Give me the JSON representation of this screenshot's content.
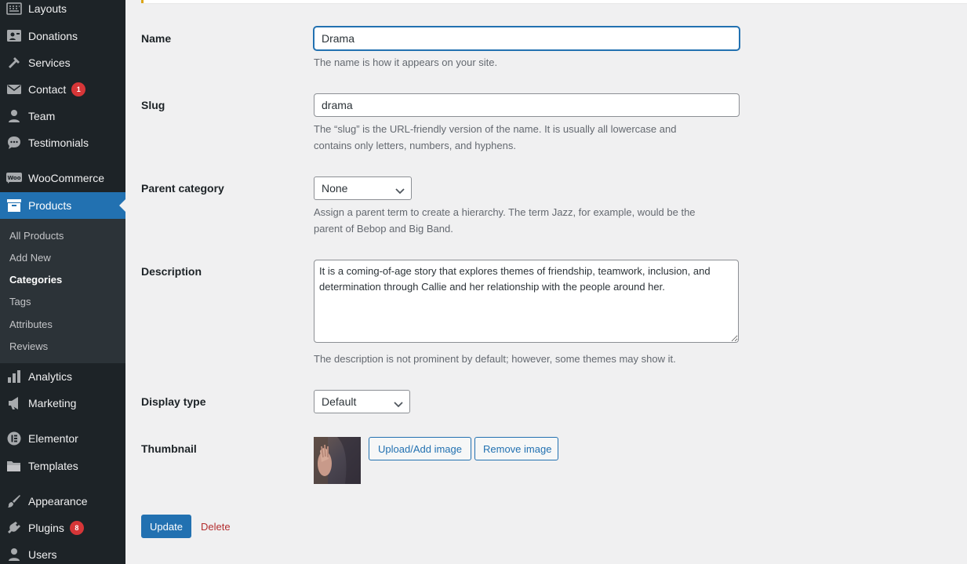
{
  "sidebar": {
    "items": [
      {
        "label": "Layouts",
        "icon": "layouts-icon"
      },
      {
        "label": "Donations",
        "icon": "donations-icon"
      },
      {
        "label": "Services",
        "icon": "hammer-icon"
      },
      {
        "label": "Contact",
        "icon": "mail-icon",
        "badge": "1"
      },
      {
        "label": "Team",
        "icon": "person-icon"
      },
      {
        "label": "Testimonials",
        "icon": "comment-icon"
      },
      {
        "label": "WooCommerce",
        "icon": "woocommerce-icon"
      },
      {
        "label": "Products",
        "icon": "archive-icon",
        "current": true
      },
      {
        "label": "Analytics",
        "icon": "bar-chart-icon"
      },
      {
        "label": "Marketing",
        "icon": "megaphone-icon"
      },
      {
        "label": "Elementor",
        "icon": "elementor-icon"
      },
      {
        "label": "Templates",
        "icon": "folder-icon"
      },
      {
        "label": "Appearance",
        "icon": "paintbrush-icon"
      },
      {
        "label": "Plugins",
        "icon": "plugin-icon",
        "badge": "8"
      },
      {
        "label": "Users",
        "icon": "users-icon"
      }
    ],
    "submenu": [
      {
        "label": "All Products"
      },
      {
        "label": "Add New"
      },
      {
        "label": "Categories",
        "current": true
      },
      {
        "label": "Tags"
      },
      {
        "label": "Attributes"
      },
      {
        "label": "Reviews"
      }
    ]
  },
  "form": {
    "name": {
      "label": "Name",
      "value": "Drama",
      "description": "The name is how it appears on your site."
    },
    "slug": {
      "label": "Slug",
      "value": "drama",
      "description_line1": "The “slug” is the URL-friendly version of the name. It is usually all lowercase and",
      "description_line2": "contains only letters, numbers, and hyphens."
    },
    "parent": {
      "label": "Parent category",
      "selected": "None",
      "description_line1": "Assign a parent term to create a hierarchy. The term Jazz, for example, would be the",
      "description_line2": "parent of Bebop and Big Band."
    },
    "description": {
      "label": "Description",
      "value": "It is a coming-of-age story that explores themes of friendship, teamwork, inclusion, and determination through Callie and her relationship with the people around her.",
      "help": "The description is not prominent by default; however, some themes may show it."
    },
    "display_type": {
      "label": "Display type",
      "selected": "Default"
    },
    "thumbnail": {
      "label": "Thumbnail",
      "upload_label": "Upload/Add image",
      "remove_label": "Remove image"
    },
    "update_label": "Update",
    "delete_label": "Delete"
  },
  "colors": {
    "sidebar_bg": "#1d2327",
    "accent": "#2271b1",
    "badge": "#d63638",
    "delete": "#b32d2e"
  }
}
